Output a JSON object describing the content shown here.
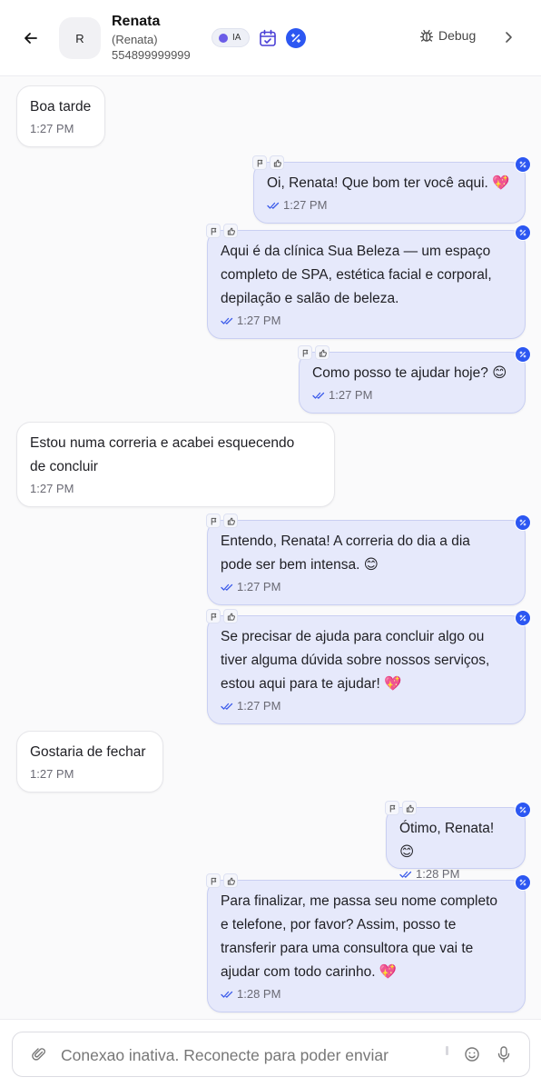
{
  "header": {
    "avatar_letter": "R",
    "contact_name": "Renata",
    "contact_subtitle": "(Renata)",
    "contact_phone": "554899999999",
    "ai_toggle_label": "IA",
    "debug_label": "Debug"
  },
  "messages": [
    {
      "direction": "incoming",
      "lines": [
        "Boa tarde"
      ],
      "time": "1:27 PM"
    },
    {
      "direction": "outgoing",
      "lines": [
        "Oi, Renata! Que bom ter você aqui. 💖"
      ],
      "time": "1:27 PM"
    },
    {
      "direction": "outgoing",
      "lines": [
        "Aqui é da clínica Sua Beleza — um espaço",
        "completo de SPA, estética facial e corporal,",
        "depilação e salão de beleza."
      ],
      "time": "1:27 PM"
    },
    {
      "direction": "outgoing",
      "lines": [
        "Como posso te ajudar hoje? 😊"
      ],
      "time": "1:27 PM"
    },
    {
      "direction": "incoming",
      "lines": [
        "Estou numa correria e acabei esquecendo",
        "de concluir"
      ],
      "time": "1:27 PM"
    },
    {
      "direction": "outgoing",
      "lines": [
        "Entendo, Renata! A correria do dia a dia",
        "pode ser bem intensa. 😊"
      ],
      "time": "1:27 PM"
    },
    {
      "direction": "outgoing",
      "lines": [
        "Se precisar de ajuda para concluir algo ou",
        "tiver alguma dúvida sobre nossos serviços,",
        "estou aqui para te ajudar! 💖"
      ],
      "time": "1:27 PM"
    },
    {
      "direction": "incoming",
      "lines": [
        "Gostaria de fechar"
      ],
      "time": "1:27 PM"
    },
    {
      "direction": "outgoing",
      "lines": [
        "Ótimo, Renata! 😊"
      ],
      "time": "1:28 PM"
    },
    {
      "direction": "outgoing",
      "lines": [
        "Para finalizar, me passa seu nome completo",
        "e telefone, por favor? Assim, posso te",
        "transferir para uma consultora que vai te",
        "ajudar com todo carinho. 💖"
      ],
      "time": "1:28 PM"
    }
  ],
  "composer": {
    "placeholder": "Conexao inativa. Reconecte para poder enviar"
  },
  "colors": {
    "accent": "#2c57f2",
    "outgoing_bubble": "#e6e9fb",
    "incoming_bubble": "#ffffff",
    "ia_dot": "#6b5ce7"
  },
  "icons": {
    "back": "arrow-left-icon",
    "calendar": "calendar-check-icon",
    "ai": "ai-sparkle-icon",
    "debug": "bug-icon",
    "next": "chevron-right-icon",
    "flag": "flag-icon",
    "like": "thumbs-up-icon",
    "read": "double-check-icon",
    "attach": "paperclip-icon",
    "emoji": "smile-icon",
    "mic": "microphone-icon"
  }
}
